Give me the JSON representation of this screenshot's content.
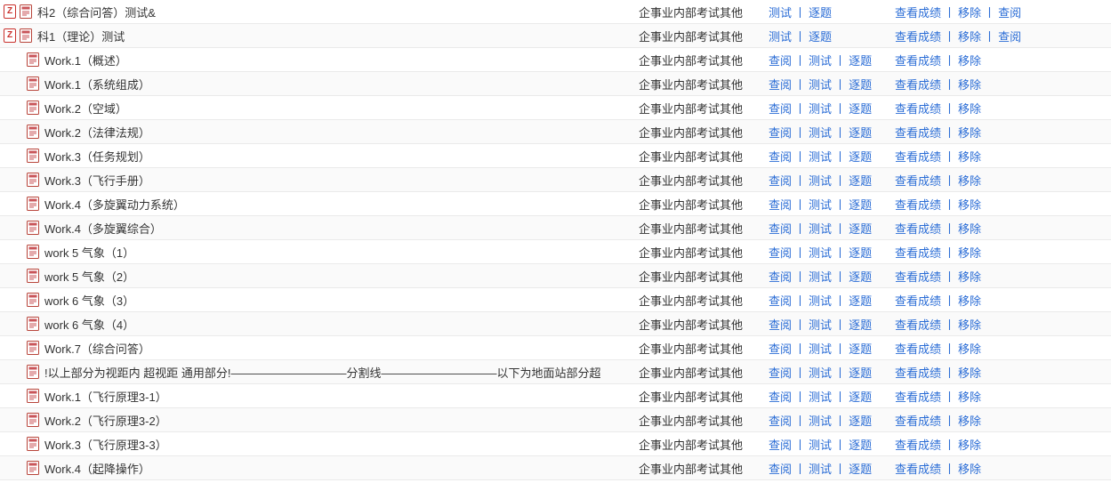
{
  "category_label": "企事业内部考试其他",
  "action_labels": {
    "test": "测试",
    "each": "逐题",
    "view": "查阅",
    "scores": "查看成绩",
    "remove": "移除"
  },
  "separator": "丨",
  "rows": [
    {
      "indent": 0,
      "icons": [
        "z",
        "doc"
      ],
      "title": "科2（综合问答）测试&",
      "actions1": [
        "test",
        "each"
      ],
      "actions2": [
        "scores",
        "remove",
        "view"
      ]
    },
    {
      "indent": 0,
      "icons": [
        "z",
        "doc"
      ],
      "title": "科1（理论）测试",
      "actions1": [
        "test",
        "each"
      ],
      "actions2": [
        "scores",
        "remove",
        "view"
      ]
    },
    {
      "indent": 1,
      "icons": [
        "doc"
      ],
      "title": "Work.1（概述）",
      "actions1": [
        "view",
        "test",
        "each"
      ],
      "actions2": [
        "scores",
        "remove"
      ]
    },
    {
      "indent": 1,
      "icons": [
        "doc"
      ],
      "title": "Work.1（系统组成）",
      "actions1": [
        "view",
        "test",
        "each"
      ],
      "actions2": [
        "scores",
        "remove"
      ]
    },
    {
      "indent": 1,
      "icons": [
        "doc"
      ],
      "title": "Work.2（空域）",
      "actions1": [
        "view",
        "test",
        "each"
      ],
      "actions2": [
        "scores",
        "remove"
      ]
    },
    {
      "indent": 1,
      "icons": [
        "doc"
      ],
      "title": "Work.2（法律法规）",
      "actions1": [
        "view",
        "test",
        "each"
      ],
      "actions2": [
        "scores",
        "remove"
      ]
    },
    {
      "indent": 1,
      "icons": [
        "doc"
      ],
      "title": "Work.3（任务规划）",
      "actions1": [
        "view",
        "test",
        "each"
      ],
      "actions2": [
        "scores",
        "remove"
      ]
    },
    {
      "indent": 1,
      "icons": [
        "doc"
      ],
      "title": "Work.3（飞行手册）",
      "actions1": [
        "view",
        "test",
        "each"
      ],
      "actions2": [
        "scores",
        "remove"
      ]
    },
    {
      "indent": 1,
      "icons": [
        "doc"
      ],
      "title": "Work.4（多旋翼动力系统）",
      "actions1": [
        "view",
        "test",
        "each"
      ],
      "actions2": [
        "scores",
        "remove"
      ]
    },
    {
      "indent": 1,
      "icons": [
        "doc"
      ],
      "title": "Work.4（多旋翼综合）",
      "actions1": [
        "view",
        "test",
        "each"
      ],
      "actions2": [
        "scores",
        "remove"
      ]
    },
    {
      "indent": 1,
      "icons": [
        "doc"
      ],
      "title": "work 5 气象（1）",
      "actions1": [
        "view",
        "test",
        "each"
      ],
      "actions2": [
        "scores",
        "remove"
      ]
    },
    {
      "indent": 1,
      "icons": [
        "doc"
      ],
      "title": "work 5 气象（2）",
      "actions1": [
        "view",
        "test",
        "each"
      ],
      "actions2": [
        "scores",
        "remove"
      ]
    },
    {
      "indent": 1,
      "icons": [
        "doc"
      ],
      "title": "work 6 气象（3）",
      "actions1": [
        "view",
        "test",
        "each"
      ],
      "actions2": [
        "scores",
        "remove"
      ]
    },
    {
      "indent": 1,
      "icons": [
        "doc"
      ],
      "title": "work 6 气象（4）",
      "actions1": [
        "view",
        "test",
        "each"
      ],
      "actions2": [
        "scores",
        "remove"
      ]
    },
    {
      "indent": 1,
      "icons": [
        "doc"
      ],
      "title": "Work.7（综合问答）",
      "actions1": [
        "view",
        "test",
        "each"
      ],
      "actions2": [
        "scores",
        "remove"
      ]
    },
    {
      "indent": 1,
      "icons": [
        "doc"
      ],
      "title": "!以上部分为视距内 超视距 通用部分!——————————分割线——————————以下为地面站部分超",
      "actions1": [
        "view",
        "test",
        "each"
      ],
      "actions2": [
        "scores",
        "remove"
      ]
    },
    {
      "indent": 1,
      "icons": [
        "doc"
      ],
      "title": "Work.1（飞行原理3-1）",
      "actions1": [
        "view",
        "test",
        "each"
      ],
      "actions2": [
        "scores",
        "remove"
      ]
    },
    {
      "indent": 1,
      "icons": [
        "doc"
      ],
      "title": "Work.2（飞行原理3-2）",
      "actions1": [
        "view",
        "test",
        "each"
      ],
      "actions2": [
        "scores",
        "remove"
      ]
    },
    {
      "indent": 1,
      "icons": [
        "doc"
      ],
      "title": "Work.3（飞行原理3-3）",
      "actions1": [
        "view",
        "test",
        "each"
      ],
      "actions2": [
        "scores",
        "remove"
      ]
    },
    {
      "indent": 1,
      "icons": [
        "doc"
      ],
      "title": "Work.4（起降操作）",
      "actions1": [
        "view",
        "test",
        "each"
      ],
      "actions2": [
        "scores",
        "remove"
      ]
    }
  ]
}
